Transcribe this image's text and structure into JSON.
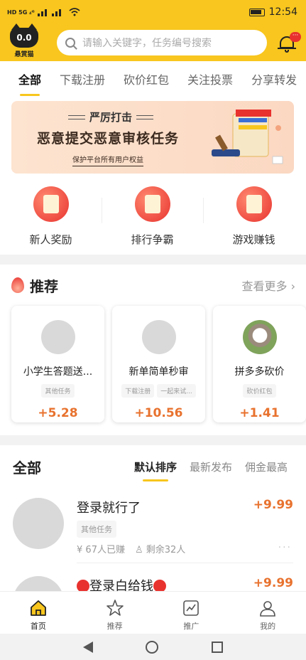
{
  "status_bar": {
    "left": "HD 5G ₄ᴳ",
    "time": "12:54"
  },
  "header": {
    "logo_face": "0.0",
    "logo_text": "悬赏猫",
    "search_placeholder": "请输入关键字，任务编号搜索",
    "notification_badge": "···"
  },
  "categories": [
    "全部",
    "下载注册",
    "砍价红包",
    "关注投票",
    "分享转发"
  ],
  "banner": {
    "title": "严厉打击",
    "headline": "恶意提交恶意审核任务",
    "sub": "保护平台所有用户权益"
  },
  "quick_links": [
    {
      "label": "新人奖励",
      "icon": "gift-list-icon"
    },
    {
      "label": "排行争霸",
      "icon": "rank-chart-icon"
    },
    {
      "label": "游戏赚钱",
      "icon": "gamepad-icon"
    }
  ],
  "recommend": {
    "title": "推荐",
    "more": "查看更多",
    "cards": [
      {
        "title": "小学生答题送...",
        "tags": [
          "其他任务"
        ],
        "price": "+5.28"
      },
      {
        "title": "新单简单秒审",
        "tags": [
          "下载注册",
          "一起来试..."
        ],
        "price": "+10.56"
      },
      {
        "title": "拼多多砍价",
        "tags": [
          "砍价红包"
        ],
        "price": "+1.41"
      }
    ]
  },
  "all_section": {
    "title": "全部",
    "sorts": [
      "默认排序",
      "最新发布",
      "佣金最高"
    ],
    "items": [
      {
        "title": "登录就行了",
        "tag": "其他任务",
        "price": "+9.99",
        "earned": "67人已赚",
        "remaining": "剩余32人"
      },
      {
        "title": "登录白给钱",
        "price": "+9.99"
      }
    ]
  },
  "tabbar": [
    "首页",
    "推荐",
    "推广",
    "我的"
  ],
  "colors": {
    "brand": "#f8c61e",
    "accent_red": "#e8322e",
    "price_orange": "#e8722e"
  }
}
